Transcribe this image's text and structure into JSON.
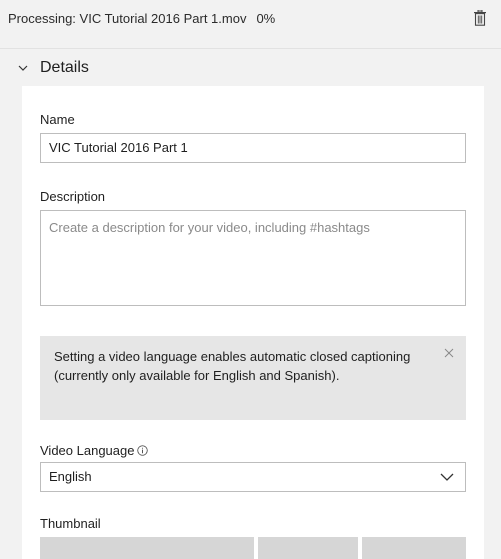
{
  "header": {
    "title": "Processing: VIC Tutorial 2016 Part 1.mov",
    "progress": "0%",
    "delete_icon": "trash-icon"
  },
  "details": {
    "label": "Details",
    "toggle_icon": "chevron-down-icon"
  },
  "form": {
    "name_label": "Name",
    "name_value": "VIC Tutorial 2016 Part 1",
    "description_label": "Description",
    "description_placeholder": "Create a description for your video, including #hashtags",
    "notice_text": "Setting a video language enables automatic closed captioning (currently only available for English and Spanish).",
    "notice_close_icon": "close-icon",
    "language_label": "Video Language",
    "language_info_icon": "info-icon",
    "language_value": "English",
    "language_caret_icon": "chevron-down-icon",
    "thumbnail_label": "Thumbnail"
  },
  "colors": {
    "background": "#f2f2f2",
    "panel": "#ffffff",
    "notice_bg": "#e6e6e6",
    "border": "#bdbdbd",
    "thumbnail_placeholder": "#d6d6d6"
  }
}
